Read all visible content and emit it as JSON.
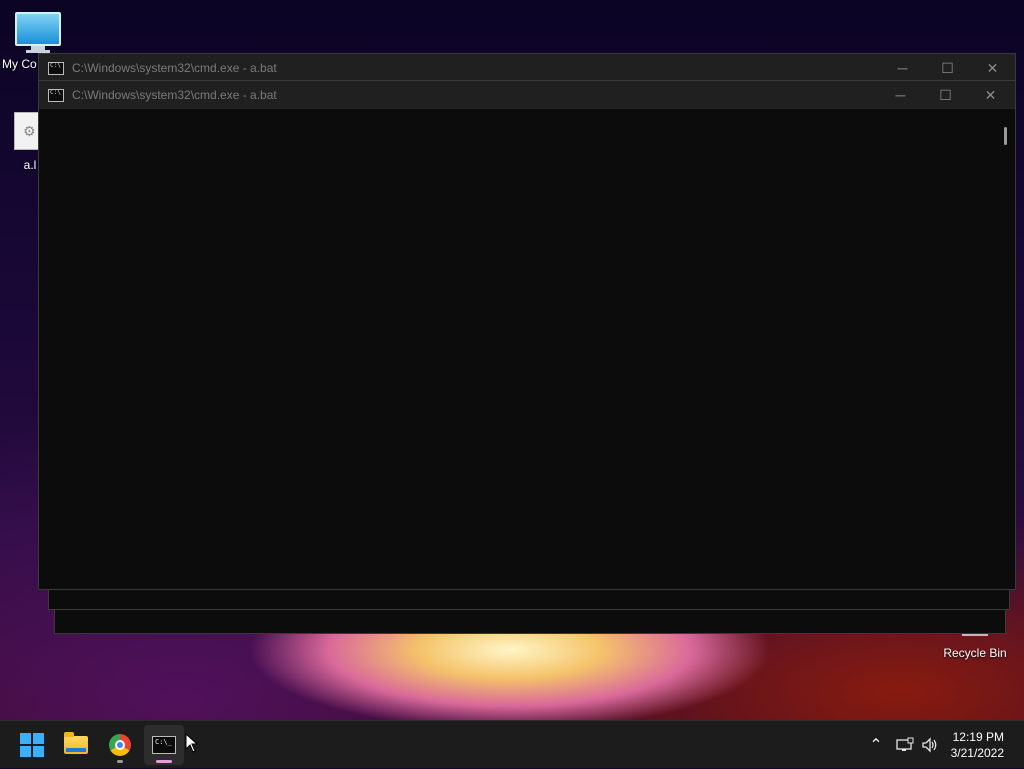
{
  "desktop": {
    "icons": [
      {
        "label": "My Co",
        "icon": "monitor-icon"
      },
      {
        "label": "a.l",
        "icon": "batch-file-icon"
      },
      {
        "label": "Recycle Bin",
        "icon": "recycle-bin-icon"
      }
    ]
  },
  "windows": [
    {
      "title": "C:\\Windows\\system32\\cmd.exe - a.bat",
      "minimize": "─",
      "maximize": "☐",
      "close": "✕"
    },
    {
      "title": "C:\\Windows\\system32\\cmd.exe - a.bat",
      "minimize": "─",
      "maximize": "☐",
      "close": "✕"
    }
  ],
  "taskbar": {
    "items": [
      {
        "name": "start",
        "icon": "windows-logo-icon"
      },
      {
        "name": "file-explorer",
        "icon": "folder-icon"
      },
      {
        "name": "chrome",
        "icon": "chrome-icon"
      },
      {
        "name": "cmd",
        "icon": "cmd-icon",
        "active": true
      }
    ],
    "tray": {
      "chevron": "^",
      "network": "network-icon",
      "volume": "volume-icon"
    },
    "clock": {
      "time": "12:19 PM",
      "date": "3/21/2022"
    }
  },
  "colors": {
    "accent": "#3ab0ff",
    "terminal_bg": "#0c0c0c",
    "titlebar_bg": "#202020",
    "taskbar_bg": "#1c1c1c"
  }
}
